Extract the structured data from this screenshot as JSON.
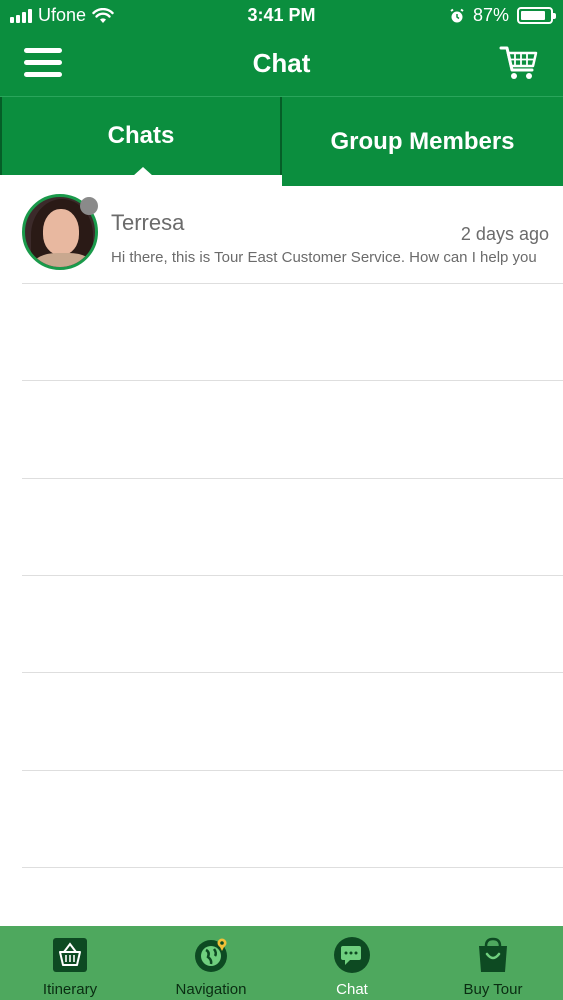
{
  "status_bar": {
    "carrier": "Ufone",
    "time": "3:41 PM",
    "battery_percent": "87%",
    "battery_level": 0.87,
    "icons": [
      "signal-icon",
      "wifi-icon",
      "alarm-icon",
      "battery-icon"
    ]
  },
  "header": {
    "title": "Chat",
    "left_icon": "hamburger-menu-icon",
    "right_icon": "cart-icon"
  },
  "tabs": [
    {
      "label": "Chats",
      "active": true
    },
    {
      "label": "Group Members",
      "active": false
    }
  ],
  "chats": [
    {
      "name": "Terresa",
      "time": "2 days ago",
      "preview": "Hi there, this is Tour East Customer Service. How can I help you",
      "status": "offline"
    }
  ],
  "bottom_nav": [
    {
      "label": "Itinerary",
      "icon": "itinerary-basket-icon",
      "active": false
    },
    {
      "label": "Navigation",
      "icon": "globe-location-icon",
      "active": false
    },
    {
      "label": "Chat",
      "icon": "chat-bubble-icon",
      "active": true
    },
    {
      "label": "Buy Tour",
      "icon": "shopping-bag-icon",
      "active": false
    }
  ],
  "colors": {
    "primary": "#0b8e3e",
    "nav_background": "#4ea85e",
    "text_gray": "#6b6b6b"
  }
}
